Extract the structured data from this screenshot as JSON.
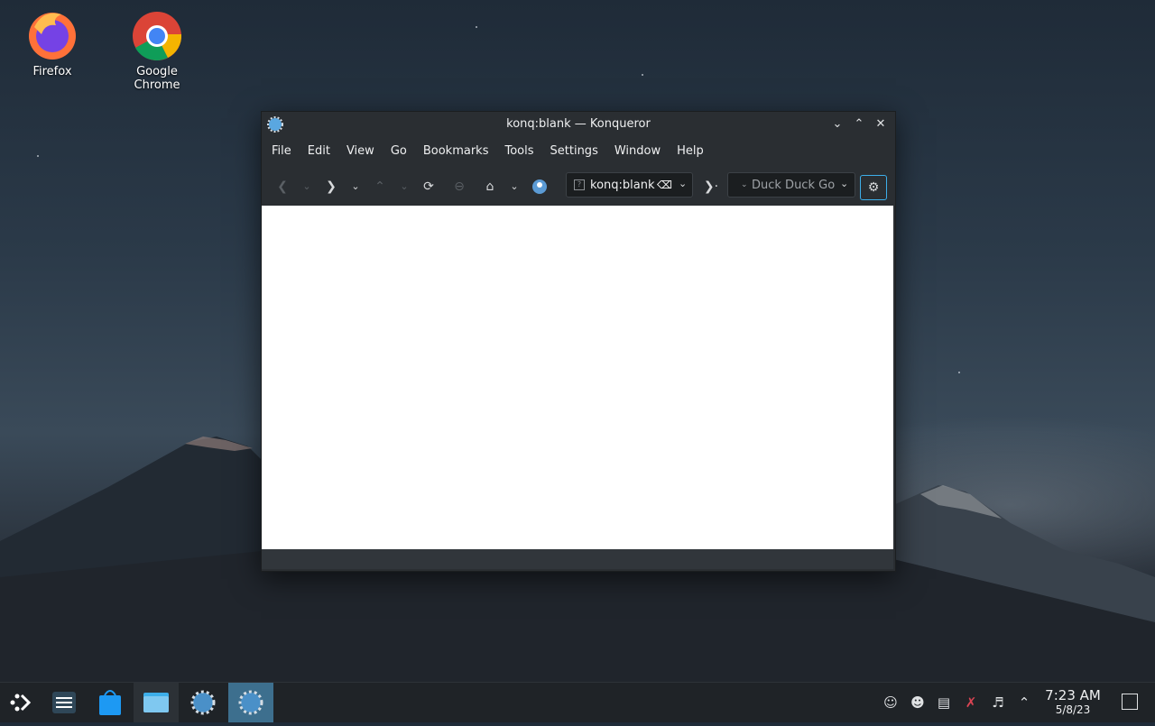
{
  "desktop": {
    "icons": [
      {
        "label": "Firefox"
      },
      {
        "label": "Google Chrome"
      }
    ]
  },
  "window": {
    "title": "konq:blank — Konqueror",
    "menu": [
      "File",
      "Edit",
      "View",
      "Go",
      "Bookmarks",
      "Tools",
      "Settings",
      "Window",
      "Help"
    ],
    "url": "konq:blank",
    "search_placeholder": "Duck Duck Go"
  },
  "taskbar": {
    "time": "7:23 AM",
    "date": "5/8/23"
  },
  "colors": {
    "accent": "#3d6f8e",
    "window_bg": "#2a2e32",
    "content_bg": "#ffffff"
  }
}
